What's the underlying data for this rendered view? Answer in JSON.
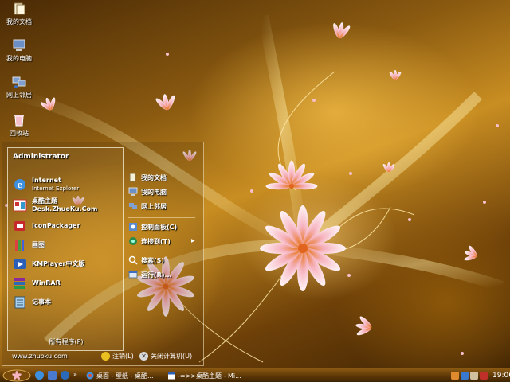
{
  "desktop": {
    "icons": [
      {
        "label": "我的文档",
        "icon": "my-documents-icon"
      },
      {
        "label": "我的电脑",
        "icon": "my-computer-icon"
      },
      {
        "label": "网上邻居",
        "icon": "network-places-icon"
      },
      {
        "label": "回收站",
        "icon": "recycle-bin-icon"
      }
    ]
  },
  "start_menu": {
    "username": "Administrator",
    "pinned": [
      {
        "title": "Internet",
        "subtitle": "Internet Explorer",
        "icon": "internet-explorer-icon"
      },
      {
        "title": "桌酷主题Desk.ZhuoKu.Com",
        "subtitle": "",
        "icon": "zhuoku-theme-icon"
      }
    ],
    "programs": [
      {
        "title": "IconPackager",
        "icon": "iconpackager-icon"
      },
      {
        "title": "画图",
        "icon": "paint-icon"
      },
      {
        "title": "KMPlayer中文版",
        "icon": "kmplayer-icon"
      },
      {
        "title": "WinRAR",
        "icon": "winrar-icon"
      },
      {
        "title": "记事本",
        "icon": "notepad-icon"
      }
    ],
    "all_programs": "所有程序(P)",
    "places": [
      {
        "label": "我的文档",
        "icon": "my-documents-icon"
      },
      {
        "label": "我的电脑",
        "icon": "my-computer-icon"
      },
      {
        "label": "网上邻居",
        "icon": "network-places-icon"
      },
      {
        "label": "控制面板(C)",
        "icon": "control-panel-icon"
      },
      {
        "label": "连接到(T)",
        "icon": "connect-to-icon"
      },
      {
        "label": "搜索(S)",
        "icon": "search-icon"
      },
      {
        "label": "运行(R)...",
        "icon": "run-icon"
      }
    ],
    "site": "www.zhuoku.com",
    "logoff_label": "注销(L)",
    "shutdown_label": "关闭计算机(U)"
  },
  "taskbar": {
    "tasks": [
      {
        "label": "桌面 - 壁纸 - 桌酷...",
        "icon": "browser-icon"
      },
      {
        "label": "-=>>桌酷主题 - Mi...",
        "icon": "word-document-icon"
      }
    ],
    "tray_icons": [
      "tray-user-icon",
      "tray-network-icon",
      "tray-volume-icon",
      "tray-shield-icon"
    ],
    "clock": "19:06"
  },
  "colors": {
    "accent": "#c98e22",
    "taskbar": "#5a3506",
    "flower_pink": "#f6b4c0"
  }
}
